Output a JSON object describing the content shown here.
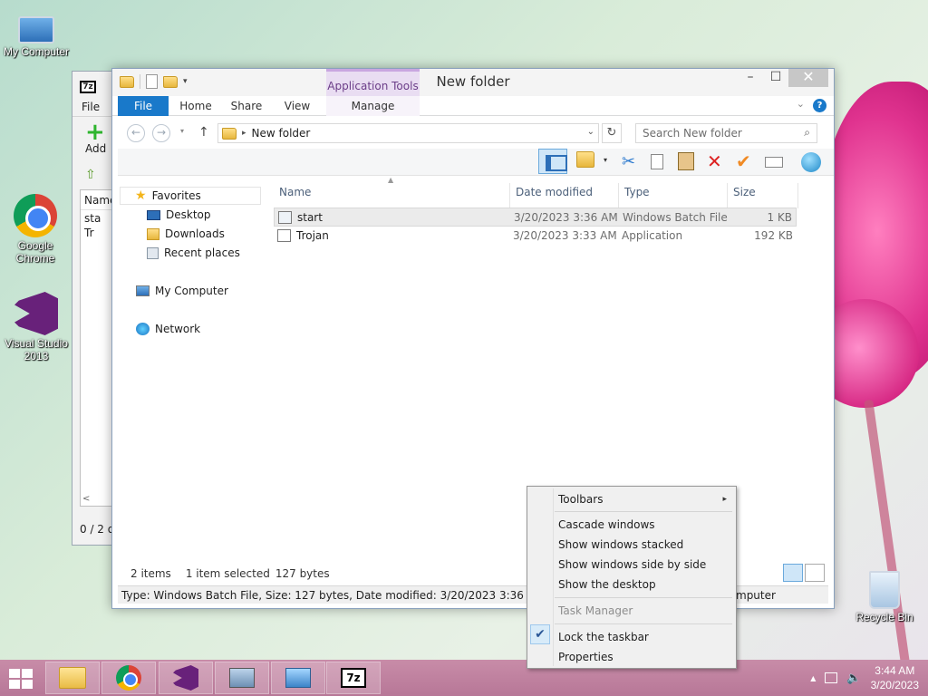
{
  "desktop": {
    "icons": {
      "my_computer": "My Computer",
      "chrome": "Google Chrome",
      "visual_studio": "Visual Studio 2013",
      "recycle_bin": "Recycle Bin"
    }
  },
  "sevenzip": {
    "badge": "7z",
    "menu_file": "File",
    "add_label": "Add",
    "col_name": "Name",
    "items": [
      "sta",
      "Tr"
    ],
    "status": "0 / 2 o"
  },
  "explorer": {
    "title": "New folder",
    "app_tools": "Application Tools",
    "tabs": {
      "file": "File",
      "home": "Home",
      "share": "Share",
      "view": "View",
      "manage": "Manage"
    },
    "address": {
      "path": "New folder"
    },
    "search": {
      "placeholder": "Search New folder"
    },
    "nav": {
      "favorites": "Favorites",
      "desktop": "Desktop",
      "downloads": "Downloads",
      "recent": "Recent places",
      "my_computer": "My Computer",
      "network": "Network"
    },
    "columns": {
      "name": "Name",
      "date": "Date modified",
      "type": "Type",
      "size": "Size"
    },
    "files": [
      {
        "name": "start",
        "date": "3/20/2023 3:36 AM",
        "type": "Windows Batch File",
        "size": "1 KB",
        "selected": true
      },
      {
        "name": "Trojan",
        "date": "3/20/2023 3:33 AM",
        "type": "Application",
        "size": "192 KB",
        "selected": false
      }
    ],
    "status": {
      "count": "2 items",
      "selected": "1 item selected",
      "bytes": "127 bytes"
    },
    "infobar": "Type: Windows Batch File, Size: 127 bytes, Date modified: 3/20/2023 3:36 AM",
    "infobar_behind": "mputer"
  },
  "context_menu": {
    "items": {
      "toolbars": "Toolbars",
      "cascade": "Cascade windows",
      "stacked": "Show windows stacked",
      "side_by_side": "Show windows side by side",
      "show_desktop": "Show the desktop",
      "task_manager": "Task Manager",
      "lock_taskbar": "Lock the taskbar",
      "properties": "Properties"
    },
    "checked": "Lock the taskbar"
  },
  "taskbar": {
    "time": "3:44 AM",
    "date": "3/20/2023",
    "badge_7z": "7z"
  },
  "colors": {
    "accent": "#1979ca",
    "app_tools": "#e9ddf2",
    "taskbar": "#c88ca8"
  }
}
